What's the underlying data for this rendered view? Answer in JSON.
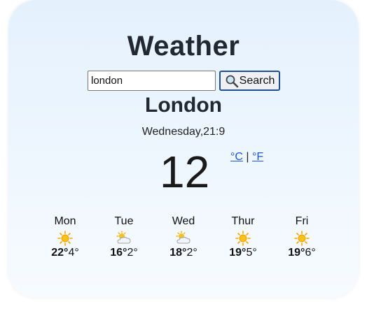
{
  "app": {
    "title": "Weather"
  },
  "search": {
    "value": "london",
    "button_label": "Search",
    "icon": "magnifier-icon"
  },
  "current": {
    "city": "London",
    "datetime": "Wednesday,21:9",
    "temperature": "12",
    "unit_celsius": "°C",
    "unit_separator": "|",
    "unit_fahrenheit": "°F"
  },
  "forecast": [
    {
      "day": "Mon",
      "icon": "sun-icon",
      "high": "22°",
      "low": "4°"
    },
    {
      "day": "Tue",
      "icon": "partly-cloudy-icon",
      "high": "16°",
      "low": "2°"
    },
    {
      "day": "Wed",
      "icon": "partly-cloudy-icon",
      "high": "18°",
      "low": "2°"
    },
    {
      "day": "Thur",
      "icon": "sun-icon",
      "high": "19°",
      "low": "5°"
    },
    {
      "day": "Fri",
      "icon": "sun-icon",
      "high": "19°",
      "low": "6°"
    }
  ],
  "colors": {
    "title_text": "#222831",
    "link": "#1a56db",
    "button_border": "#1d4f91",
    "sun": "#f5b301"
  }
}
